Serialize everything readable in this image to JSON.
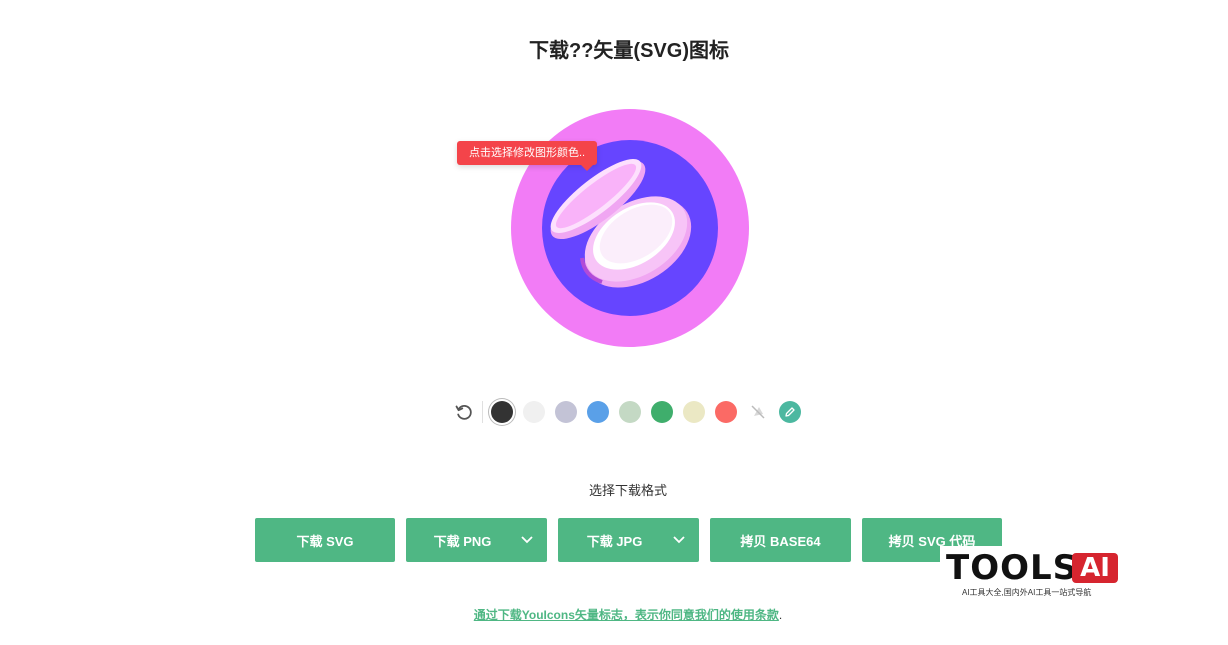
{
  "page": {
    "title": "下载??矢量(SVG)图标"
  },
  "preview": {
    "tooltip": "点击选择修改图形颜色..",
    "colors": {
      "outer_ring": "#f27cf6",
      "inner_circle": "#6645ff",
      "lid": "#f9b3f9",
      "lid_light": "#fde0fd",
      "base": "#f7c4f7",
      "powder": "#fbeefb",
      "accent": "#b14bd8"
    }
  },
  "palette": {
    "reset_icon": "rotate-ccw-icon",
    "swatches": [
      {
        "name": "dark",
        "color": "#333333",
        "selected": true
      },
      {
        "name": "light-gray",
        "color": "#f0f0f0",
        "selected": false
      },
      {
        "name": "lavender",
        "color": "#c3c3d6",
        "selected": false
      },
      {
        "name": "blue",
        "color": "#5aa0e8",
        "selected": false
      },
      {
        "name": "sage",
        "color": "#c4d9c4",
        "selected": false
      },
      {
        "name": "green",
        "color": "#3fae6c",
        "selected": false
      },
      {
        "name": "cream",
        "color": "#ebe8c4",
        "selected": false
      },
      {
        "name": "coral",
        "color": "#fb6a65",
        "selected": false
      }
    ],
    "no_fill_icon": "no-fill-icon",
    "picker_icon": "pencil-icon",
    "picker_color": "#4cb8a0"
  },
  "download": {
    "label": "选择下载格式",
    "buttons": [
      {
        "label": "下载 SVG",
        "dropdown": false
      },
      {
        "label": "下载 PNG",
        "dropdown": true
      },
      {
        "label": "下载 JPG",
        "dropdown": true
      },
      {
        "label": "拷贝 BASE64",
        "dropdown": false
      },
      {
        "label": "拷贝 SVG 代码",
        "dropdown": false
      }
    ],
    "button_color": "#4fb784"
  },
  "terms": {
    "link": "通过下载YouIcons矢量标志，表示你同意我们的使用条款",
    "tail": "."
  },
  "watermark": {
    "main": "TOOLS",
    "badge": "AI",
    "sub": "AI工具大全,国内外AI工具一站式导航"
  }
}
